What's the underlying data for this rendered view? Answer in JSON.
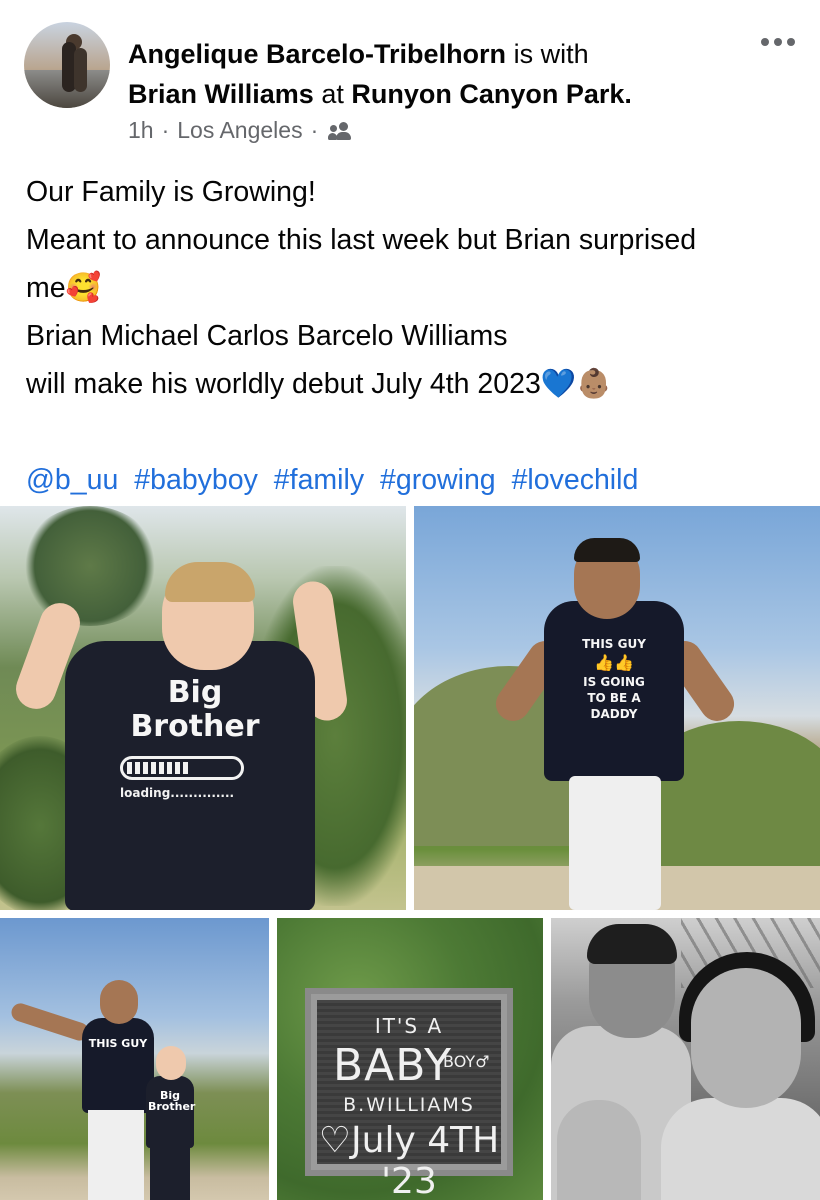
{
  "post": {
    "author": "Angelique Barcelo-Tribelhorn",
    "with_word": "is with",
    "tagged_person": "Brian Williams",
    "at_word": "at",
    "location_tag": "Runyon Canyon Park.",
    "time": "1h",
    "place": "Los Angeles",
    "separator": "·",
    "audience_icon": "friends-icon",
    "more_icon": "more-options-icon",
    "text_lines": [
      "Our Family is Growing!",
      "Meant to announce this last week but Brian surprised",
      "me🥰",
      "Brian Michael Carlos Barcelo Williams",
      "will make his worldly debut July 4th 2023💙👶🏽"
    ],
    "mention": "@b_uu",
    "hashtags": [
      "#babyboy",
      "#family",
      "#growing",
      "#lovechild"
    ]
  },
  "photos": {
    "photo1": {
      "shirt_line1": "Big",
      "shirt_line2": "Brother",
      "loading_text": "loading..............",
      "loading_fraction": 0.55
    },
    "photo2": {
      "shirt_line1": "THIS GUY",
      "shirt_line2": "IS GOING",
      "shirt_line3": "TO BE A",
      "shirt_line4": "DADDY"
    },
    "photo3": {
      "man_shirt": "THIS GUY",
      "boy_shirt": "Big Brother"
    },
    "photo4": {
      "row1": "IT'S A",
      "row2": "BABY",
      "row2_suffix": "BOY♂",
      "row3": "B.WILLIAMS",
      "row4": "♡July 4TH '23"
    }
  }
}
